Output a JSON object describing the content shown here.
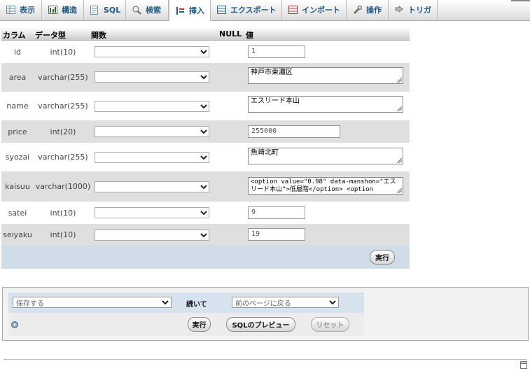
{
  "tabs": [
    {
      "label": "表示",
      "icon": "table-icon"
    },
    {
      "label": "構造",
      "icon": "structure-icon"
    },
    {
      "label": "SQL",
      "icon": "sql-icon"
    },
    {
      "label": "検索",
      "icon": "search-icon"
    },
    {
      "label": "挿入",
      "icon": "insert-icon"
    },
    {
      "label": "エクスポート",
      "icon": "export-icon"
    },
    {
      "label": "インポート",
      "icon": "import-icon"
    },
    {
      "label": "操作",
      "icon": "wrench-icon"
    },
    {
      "label": "トリガ",
      "icon": "trigger-icon"
    }
  ],
  "active_tab": "挿入",
  "table_header": {
    "column": "カラム",
    "type": "データ型",
    "function": "関数",
    "null": "NULL",
    "value": "値"
  },
  "rows": [
    {
      "name": "id",
      "type": "int(10)",
      "value": "1"
    },
    {
      "name": "area",
      "type": "varchar(255)",
      "value": "神戸市東灘区"
    },
    {
      "name": "name",
      "type": "varchar(255)",
      "value": "エスリード本山"
    },
    {
      "name": "price",
      "type": "int(20)",
      "value": "255000"
    },
    {
      "name": "syozai",
      "type": "varchar(255)",
      "value": "魚崎北町"
    },
    {
      "name": "kaisuu",
      "type": "varchar(1000)",
      "value_line1": "<option value=\"0.98\" data-manshon=\"エス",
      "value_line2": "リード本山\">低層階</option> <option"
    },
    {
      "name": "satei",
      "type": "int(10)",
      "value": "9"
    },
    {
      "name": "seiyaku",
      "type": "int(10)",
      "value": "19"
    }
  ],
  "execute_label": "実行",
  "bottom": {
    "save_select": "保存する",
    "continue_label": "続いて",
    "after_select": "前のページに戻る",
    "execute_label": "実行",
    "preview_label": "SQLのプレビュー",
    "reset_label": "リセット"
  },
  "colors": {
    "link": "#235a81",
    "row_alt": "#dfdfdf",
    "footer_bg": "#d0dde9"
  }
}
